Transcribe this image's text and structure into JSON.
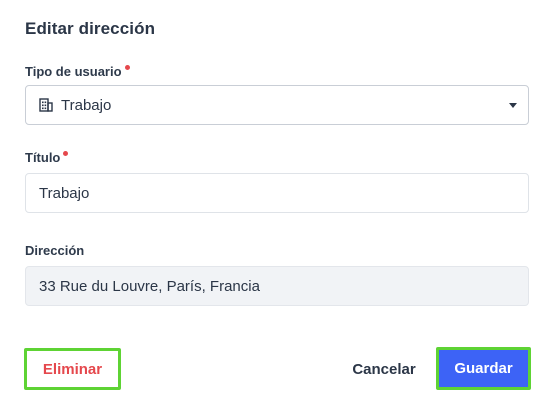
{
  "dialog": {
    "title": "Editar dirección"
  },
  "user_type": {
    "label": "Tipo de usuario",
    "required": true,
    "value": "Trabajo",
    "icon": "building-icon"
  },
  "title_field": {
    "label": "Título",
    "required": true,
    "value": "Trabajo"
  },
  "address": {
    "label": "Dirección",
    "value": "33 Rue du Louvre, París, Francia",
    "disabled": true
  },
  "actions": {
    "delete_label": "Eliminar",
    "cancel_label": "Cancelar",
    "save_label": "Guardar"
  },
  "colors": {
    "required_dot": "#e5484d",
    "primary": "#3d63f6",
    "danger": "#e5484d",
    "highlight_outline": "#5ed334"
  }
}
